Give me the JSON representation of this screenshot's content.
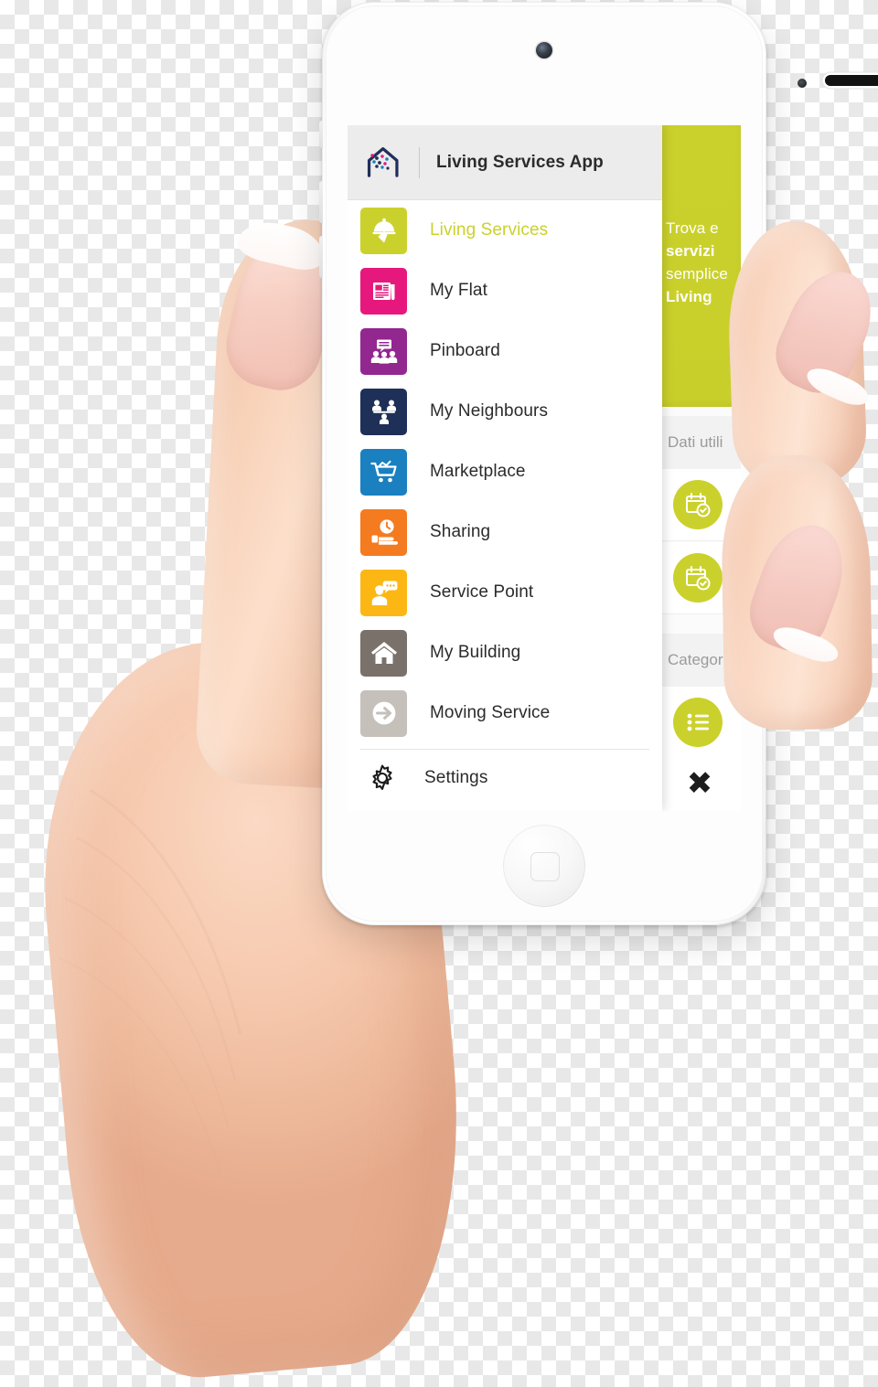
{
  "app": {
    "header": {
      "title": "Living Services App",
      "logo_icon": "house-dots-logo-icon"
    },
    "menu": {
      "items": [
        {
          "label": "Living Services",
          "icon": "food-cloche-check-icon",
          "color": "#cbd12c",
          "active": true
        },
        {
          "label": "My Flat",
          "icon": "newspaper-icon",
          "color": "#e6187d",
          "active": false
        },
        {
          "label": "Pinboard",
          "icon": "pinboard-people-chat-icon",
          "color": "#922790",
          "active": false
        },
        {
          "label": "My Neighbours",
          "icon": "three-people-icon",
          "color": "#1f3058",
          "active": false
        },
        {
          "label": "Marketplace",
          "icon": "shopping-cart-icon",
          "color": "#1a80c0",
          "active": false
        },
        {
          "label": "Sharing",
          "icon": "hand-clock-icon",
          "color": "#f47b20",
          "active": false
        },
        {
          "label": "Service Point",
          "icon": "person-speech-bubble-icon",
          "color": "#fcb715",
          "active": false
        },
        {
          "label": "My Building",
          "icon": "home-icon",
          "color": "#7a716b",
          "active": false
        },
        {
          "label": "Moving Service",
          "icon": "arrow-right-circle-icon",
          "color": "#c6c0bb",
          "active": false
        }
      ],
      "settings": {
        "label": "Settings",
        "icon": "gear-icon"
      }
    },
    "background_page": {
      "promo": {
        "line1": "Trova e",
        "line2": "servizi",
        "line3": "semplice",
        "line4": "Living",
        "background_color": "#cbd12c"
      },
      "sections": [
        {
          "title": "Dati utili"
        },
        {
          "title": "Categorie"
        }
      ],
      "rows": [
        {
          "icon": "calendar-check-icon",
          "color": "#cbd12c"
        },
        {
          "icon": "calendar-check-icon",
          "color": "#cbd12c"
        },
        {
          "icon": "list-bullets-icon",
          "color": "#cbd12c"
        }
      ],
      "close_button": {
        "icon": "close-x-icon",
        "label": "✖"
      }
    }
  },
  "device": {
    "type": "white-smartphone",
    "camera_icon": "front-camera-icon",
    "sensor_icon": "proximity-sensor-icon",
    "speaker_icon": "earpiece-speaker-icon",
    "home_button_icon": "home-button-icon"
  },
  "scene": {
    "hand_description": "hand-holding-phone"
  },
  "colors": {
    "accent_green": "#cbd12c",
    "header_bg": "#ececec",
    "text_dark": "#2b2b2b",
    "muted": "#9b9b9b"
  }
}
